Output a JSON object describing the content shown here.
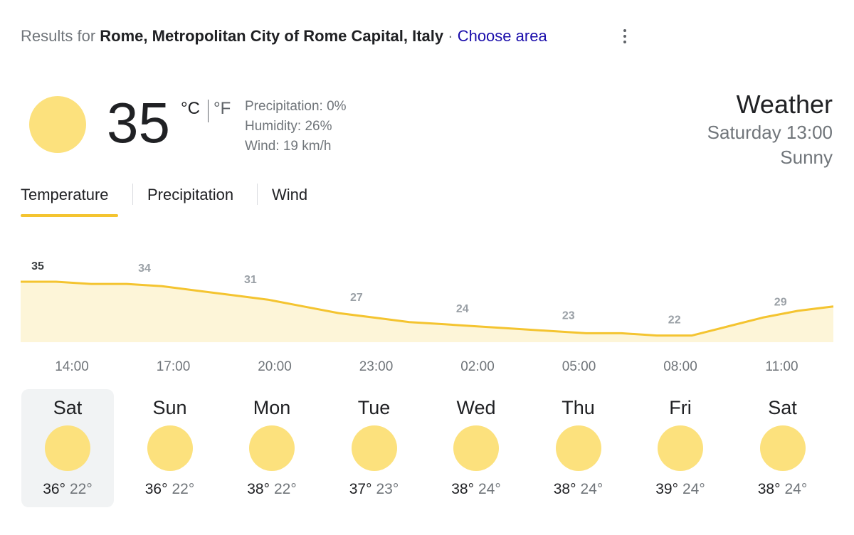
{
  "header": {
    "results_prefix": "Results for",
    "location": "Rome, Metropolitan City of Rome Capital, Italy",
    "separator": "·",
    "choose_area": "Choose area",
    "more_icon": "more-vert-icon"
  },
  "current": {
    "icon": "sun-icon",
    "temperature": "35",
    "unit_c": "°C",
    "unit_f": "°F",
    "precipitation": "Precipitation: 0%",
    "humidity": "Humidity: 26%",
    "wind": "Wind: 19 km/h"
  },
  "summary": {
    "title": "Weather",
    "time": "Saturday 13:00",
    "condition": "Sunny"
  },
  "tabs": [
    "Temperature",
    "Precipitation",
    "Wind"
  ],
  "hour_labels": [
    "14:00",
    "17:00",
    "20:00",
    "23:00",
    "02:00",
    "05:00",
    "08:00",
    "11:00"
  ],
  "chart_data": {
    "type": "area",
    "x": [
      "13:00",
      "14:00",
      "15:00",
      "16:00",
      "17:00",
      "18:00",
      "19:00",
      "20:00",
      "21:00",
      "22:00",
      "23:00",
      "00:00",
      "01:00",
      "02:00",
      "03:00",
      "04:00",
      "05:00",
      "06:00",
      "07:00",
      "08:00",
      "09:00",
      "10:00",
      "11:00",
      "12:00"
    ],
    "values": [
      35,
      35,
      34.5,
      34.5,
      34,
      33,
      32,
      31,
      29.5,
      28,
      27,
      26,
      25.5,
      25,
      24.5,
      24,
      23.5,
      23.5,
      23,
      23,
      25,
      27,
      28.5,
      29.5
    ],
    "labels": [
      {
        "index": 0,
        "text": "35"
      },
      {
        "index": 3,
        "text": "34"
      },
      {
        "index": 6,
        "text": "31"
      },
      {
        "index": 9,
        "text": "27"
      },
      {
        "index": 12,
        "text": "24"
      },
      {
        "index": 15,
        "text": "23"
      },
      {
        "index": 18,
        "text": "22"
      },
      {
        "index": 21,
        "text": "29"
      }
    ],
    "colors": {
      "line": "#f4c430",
      "fill": "#fdf5d8",
      "label_current": "#3c4043",
      "label": "#9aa0a6"
    }
  },
  "days": [
    {
      "name": "Sat",
      "hi": "36°",
      "lo": "22°",
      "icon": "sun-icon",
      "selected": true
    },
    {
      "name": "Sun",
      "hi": "36°",
      "lo": "22°",
      "icon": "sun-icon"
    },
    {
      "name": "Mon",
      "hi": "38°",
      "lo": "22°",
      "icon": "sun-icon"
    },
    {
      "name": "Tue",
      "hi": "37°",
      "lo": "23°",
      "icon": "sun-icon"
    },
    {
      "name": "Wed",
      "hi": "38°",
      "lo": "24°",
      "icon": "sun-icon"
    },
    {
      "name": "Thu",
      "hi": "38°",
      "lo": "24°",
      "icon": "sun-icon"
    },
    {
      "name": "Fri",
      "hi": "39°",
      "lo": "24°",
      "icon": "sun-icon"
    },
    {
      "name": "Sat",
      "hi": "38°",
      "lo": "24°",
      "icon": "sun-icon"
    }
  ]
}
